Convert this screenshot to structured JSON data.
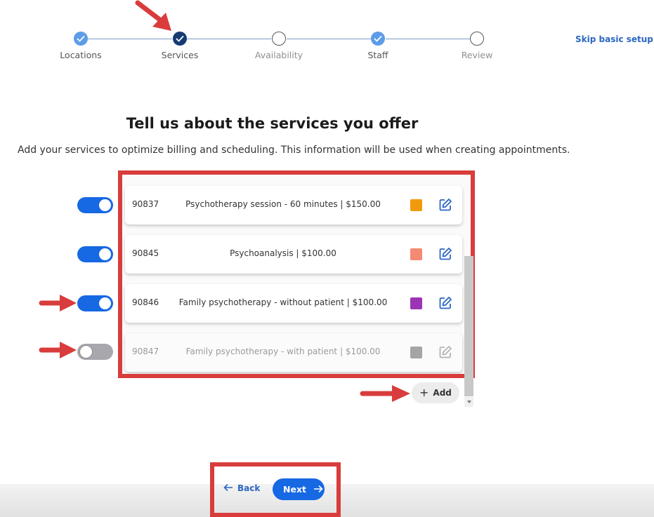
{
  "stepper": {
    "steps": [
      {
        "label": "Locations",
        "state": "done"
      },
      {
        "label": "Services",
        "state": "current"
      },
      {
        "label": "Availability",
        "state": "todo"
      },
      {
        "label": "Staff",
        "state": "done"
      },
      {
        "label": "Review",
        "state": "todo"
      }
    ],
    "skip_label": "Skip basic setup"
  },
  "heading": "Tell us about the services you offer",
  "subtitle": "Add your services to optimize billing and scheduling. This information will be used when creating appointments.",
  "services": [
    {
      "code": "90837",
      "description": "Psychotherapy session - 60 minutes | $150.00",
      "color": "#f29a0d",
      "enabled": true
    },
    {
      "code": "90845",
      "description": "Psychoanalysis | $100.00",
      "color": "#f48a74",
      "enabled": true
    },
    {
      "code": "90846",
      "description": "Family psychotherapy - without patient | $100.00",
      "color": "#9c35b5",
      "enabled": true
    },
    {
      "code": "90847",
      "description": "Family psychotherapy - with patient | $100.00",
      "color": "#a5a5a8",
      "enabled": false
    }
  ],
  "add_label": "Add",
  "footer": {
    "back_label": "Back",
    "next_label": "Next"
  },
  "colors": {
    "accent": "#1668e3",
    "annotation": "#d93c3c",
    "done_step": "#5d9ce8",
    "current_step": "#163b73"
  },
  "icons": {
    "step_done": "check-icon",
    "edit": "edit-icon",
    "add": "plus-icon",
    "back": "arrow-left-icon",
    "next": "arrow-right-icon"
  }
}
